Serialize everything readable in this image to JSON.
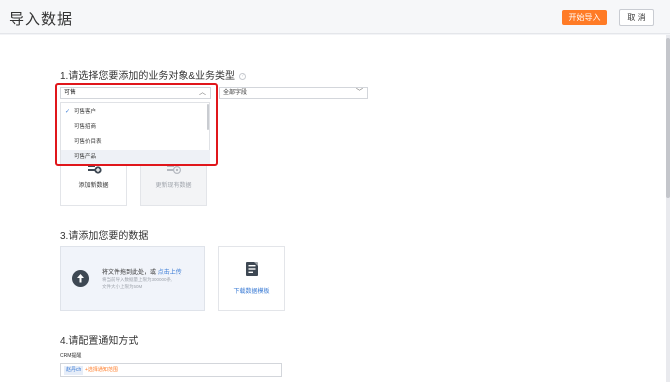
{
  "header": {
    "title": "导入数据",
    "start_button": "开始导入",
    "cancel_button": "取 消"
  },
  "step1": {
    "title": "1.请选择您要添加的业务对象&业务类型",
    "help_icon": "?",
    "object_select": {
      "value": "可售",
      "chevron": "︿"
    },
    "type_select": {
      "value": "全部字段",
      "chevron": "﹀"
    },
    "dropdown": {
      "items": [
        {
          "label": "可售客户",
          "selected": true
        },
        {
          "label": "可售招商",
          "selected": false
        },
        {
          "label": "可售价目表",
          "selected": false
        },
        {
          "label": "可售产品",
          "selected": false,
          "hovered": true
        }
      ],
      "check_mark": "✓"
    }
  },
  "step2": {
    "cards": [
      {
        "label": "添加新数据",
        "icon": "add-data-icon",
        "selected": true
      },
      {
        "label": "更新现有数据",
        "icon": "update-data-icon",
        "selected": false
      }
    ]
  },
  "step3": {
    "title": "3.请添加您要的数据",
    "upload": {
      "main_text": "将文件拖到此处，或",
      "link_text": "点击上传",
      "hint_line1": "将当前导入数据量上限为300000条,",
      "hint_line2": "文件大小上限为50M",
      "icon": "upload-arrow-icon"
    },
    "template_card": {
      "label": "下载数据模板",
      "icon": "document-icon"
    }
  },
  "step4": {
    "title": "4.请配置通知方式",
    "crm_label": "CRM提醒",
    "tag": "赵丹ch",
    "add_link": "+选择通知范围"
  },
  "colors": {
    "accent": "#ff7b26",
    "link": "#3a7bd5",
    "highlight_outline": "#e0161b"
  }
}
